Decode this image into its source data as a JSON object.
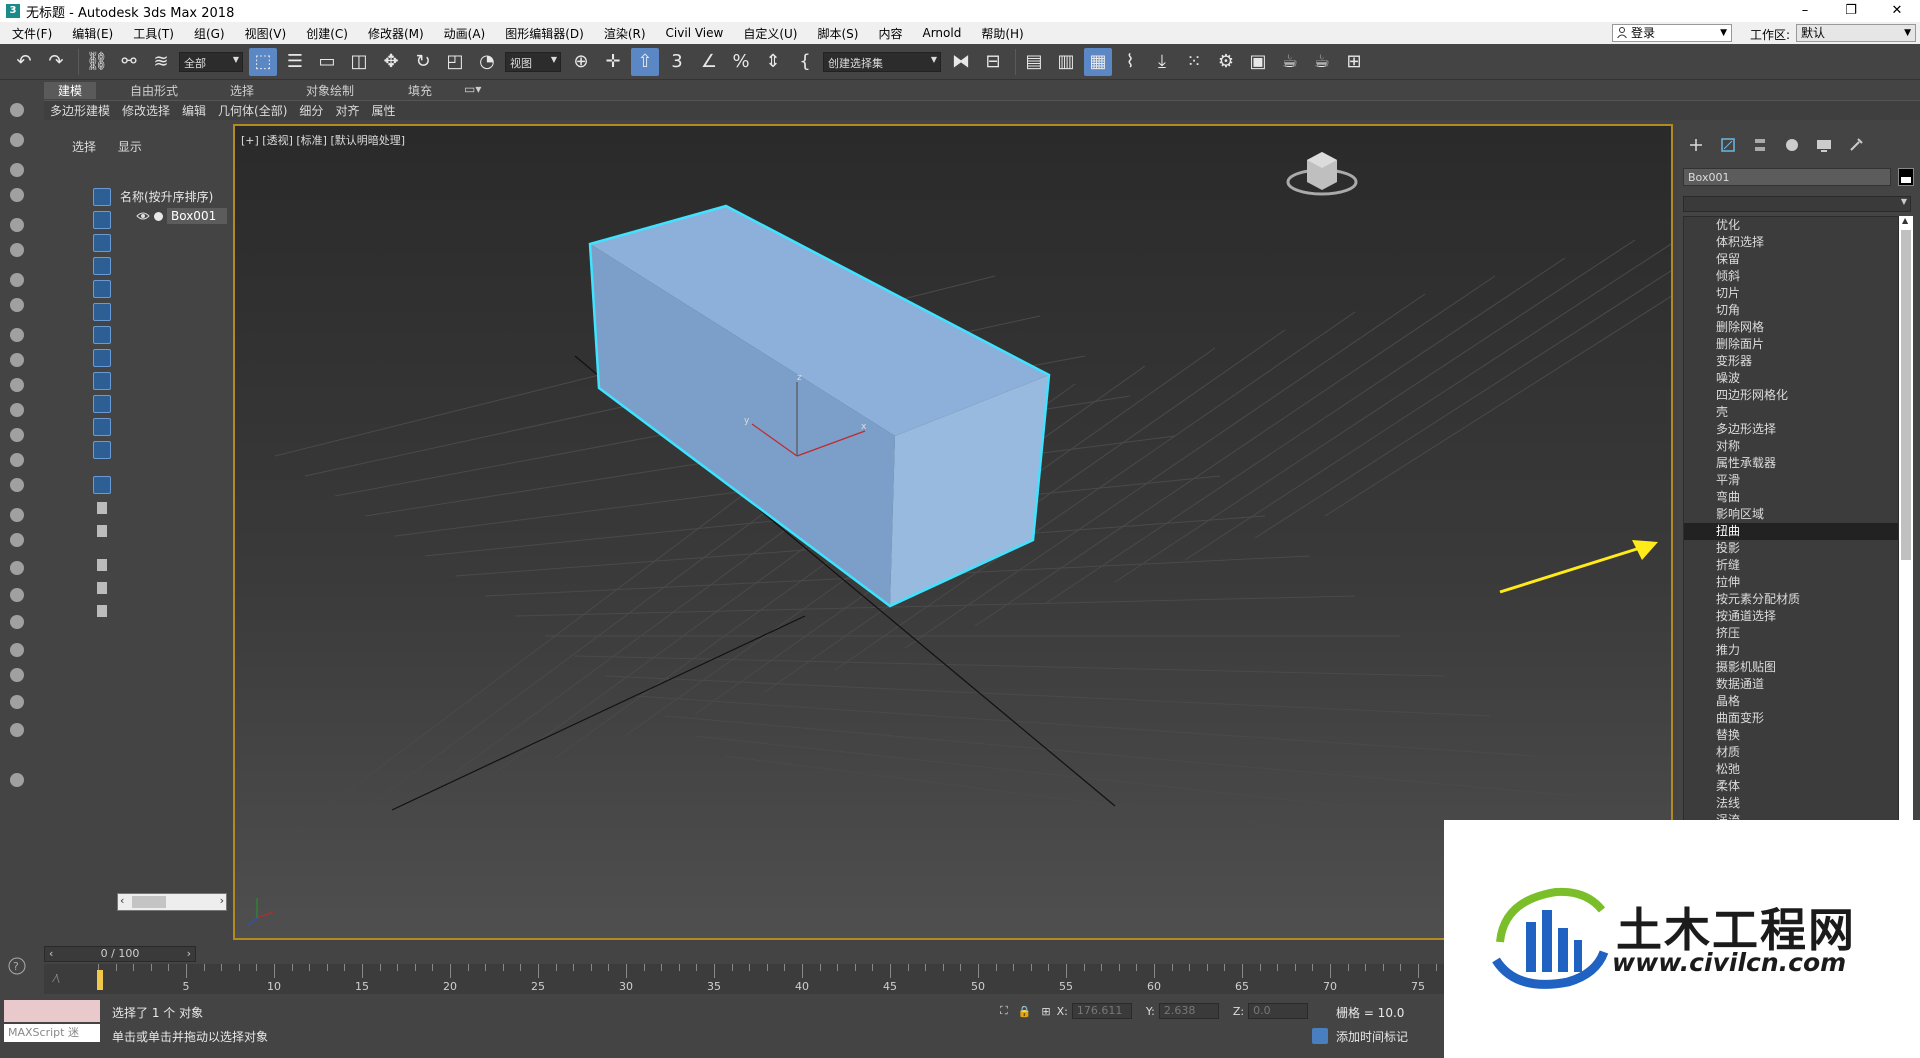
{
  "window": {
    "title": "无标题 - Autodesk 3ds Max 2018",
    "controls": [
      "–",
      "❐",
      "✕"
    ]
  },
  "menu": [
    "文件(F)",
    "编辑(E)",
    "工具(T)",
    "组(G)",
    "视图(V)",
    "创建(C)",
    "修改器(M)",
    "动画(A)",
    "图形编辑器(D)",
    "渲染(R)",
    "Civil View",
    "自定义(U)",
    "脚本(S)",
    "内容",
    "Arnold",
    "帮助(H)"
  ],
  "account": {
    "login_label": "登录",
    "workspace_label": "工作区:",
    "workspace_value": "默认"
  },
  "toolbar": {
    "selection_filter": "全部",
    "ref_coord": "视图",
    "named_selection": "创建选择集"
  },
  "ribbon": {
    "tabs": [
      "建模",
      "自由形式",
      "选择",
      "对象绘制",
      "填充"
    ],
    "active_tab": "建模",
    "sub_items": [
      "多边形建模",
      "修改选择",
      "编辑",
      "几何体(全部)",
      "细分",
      "对齐",
      "属性"
    ]
  },
  "scene_explorer": {
    "tabs": [
      "选择",
      "显示"
    ],
    "column_header": "名称(按升序排序)",
    "objects": [
      "Box001"
    ]
  },
  "viewport": {
    "label": "[+] [透视] [标准] [默认明暗处理]",
    "object_color": "#8aaed8",
    "selection_outline_color": "#3fe3ff",
    "axis_labels": {
      "x": "x",
      "y": "y",
      "z": "z"
    }
  },
  "command_panel": {
    "object_name": "Box001",
    "modifier_list": [
      "优化",
      "体积选择",
      "保留",
      "倾斜",
      "切片",
      "切角",
      "删除网格",
      "删除面片",
      "变形器",
      "噪波",
      "四边形网格化",
      "壳",
      "多边形选择",
      "对称",
      "属性承载器",
      "平滑",
      "弯曲",
      "影响区域",
      "扭曲",
      "投影",
      "折缝",
      "拉伸",
      "按元素分配材质",
      "按通道选择",
      "挤压",
      "推力",
      "摄影机贴图",
      "数据通道",
      "晶格",
      "曲面变形",
      "替换",
      "材质",
      "松弛",
      "柔体",
      "法线",
      "涡流"
    ],
    "selected_modifier": "扭曲"
  },
  "timeline": {
    "frame_display": "0 / 100",
    "ticks": [
      0,
      5,
      10,
      15,
      20,
      25,
      30,
      35,
      40,
      45,
      50,
      55,
      60,
      65,
      70,
      75
    ],
    "current_frame": 0
  },
  "status": {
    "maxscript_label": "MAXScript 迷",
    "line1": "选择了 1 个 对象",
    "line2": "单击或单击并拖动以选择对象",
    "x_label": "X:",
    "x_value": "176.611",
    "y_label": "Y:",
    "y_value": "2.638",
    "z_label": "Z:",
    "z_value": "0.0",
    "grid": "栅格 = 10.0",
    "add_time_tag": "添加时间标记"
  },
  "watermark": {
    "cn": "土木工程网",
    "url": "www.civilcn.com"
  },
  "colors": {
    "arrow": "#ffeb1a",
    "viewport_border": "#b38a20",
    "selection_blue": "#5b87c5"
  }
}
